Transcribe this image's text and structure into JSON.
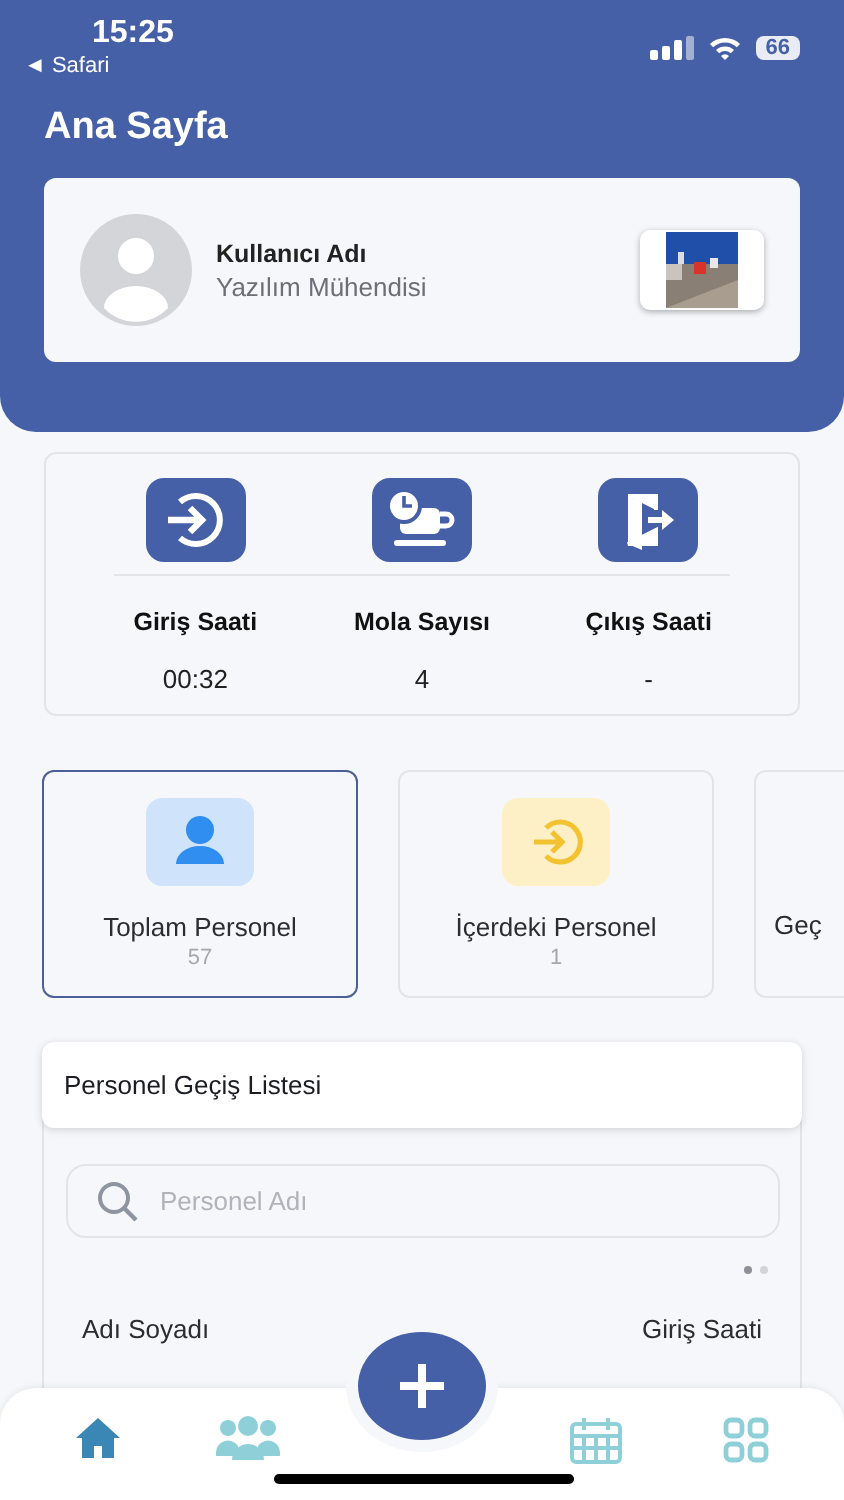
{
  "status_bar": {
    "time": "15:25",
    "back": "◄ Safari",
    "battery": "66"
  },
  "header": {
    "title": "Ana Sayfa"
  },
  "profile": {
    "name": "Kullanıcı Adı",
    "role": "Yazılım Mühendisi"
  },
  "attendance": [
    {
      "kind": "in",
      "label": "Giriş Saati",
      "value": "00:32"
    },
    {
      "kind": "break",
      "label": "Mola Sayısı",
      "value": "4"
    },
    {
      "kind": "out",
      "label": "Çıkış Saati",
      "value": "-"
    }
  ],
  "summary_cards": [
    {
      "kind": "total",
      "label": "Toplam Personel",
      "count": "57",
      "selected": true
    },
    {
      "kind": "inside",
      "label": "İçerdeki Personel",
      "count": "1",
      "selected": false
    },
    {
      "kind": "cut",
      "label": "Geç",
      "selected": false
    }
  ],
  "list": {
    "title": "Personel Geçiş Listesi",
    "search": {
      "placeholder": "Personel Adı"
    },
    "pages": [
      {
        "selected": true
      },
      {
        "selected": false
      }
    ],
    "columns": [
      "Adı Soyadı",
      "Giriş Saati"
    ]
  },
  "tab_bar": {
    "items": [
      {
        "kind": "home",
        "selected": true
      },
      {
        "kind": "people",
        "selected": false
      },
      {
        "kind": "calendar",
        "selected": false
      },
      {
        "kind": "grid",
        "selected": false
      }
    ]
  }
}
